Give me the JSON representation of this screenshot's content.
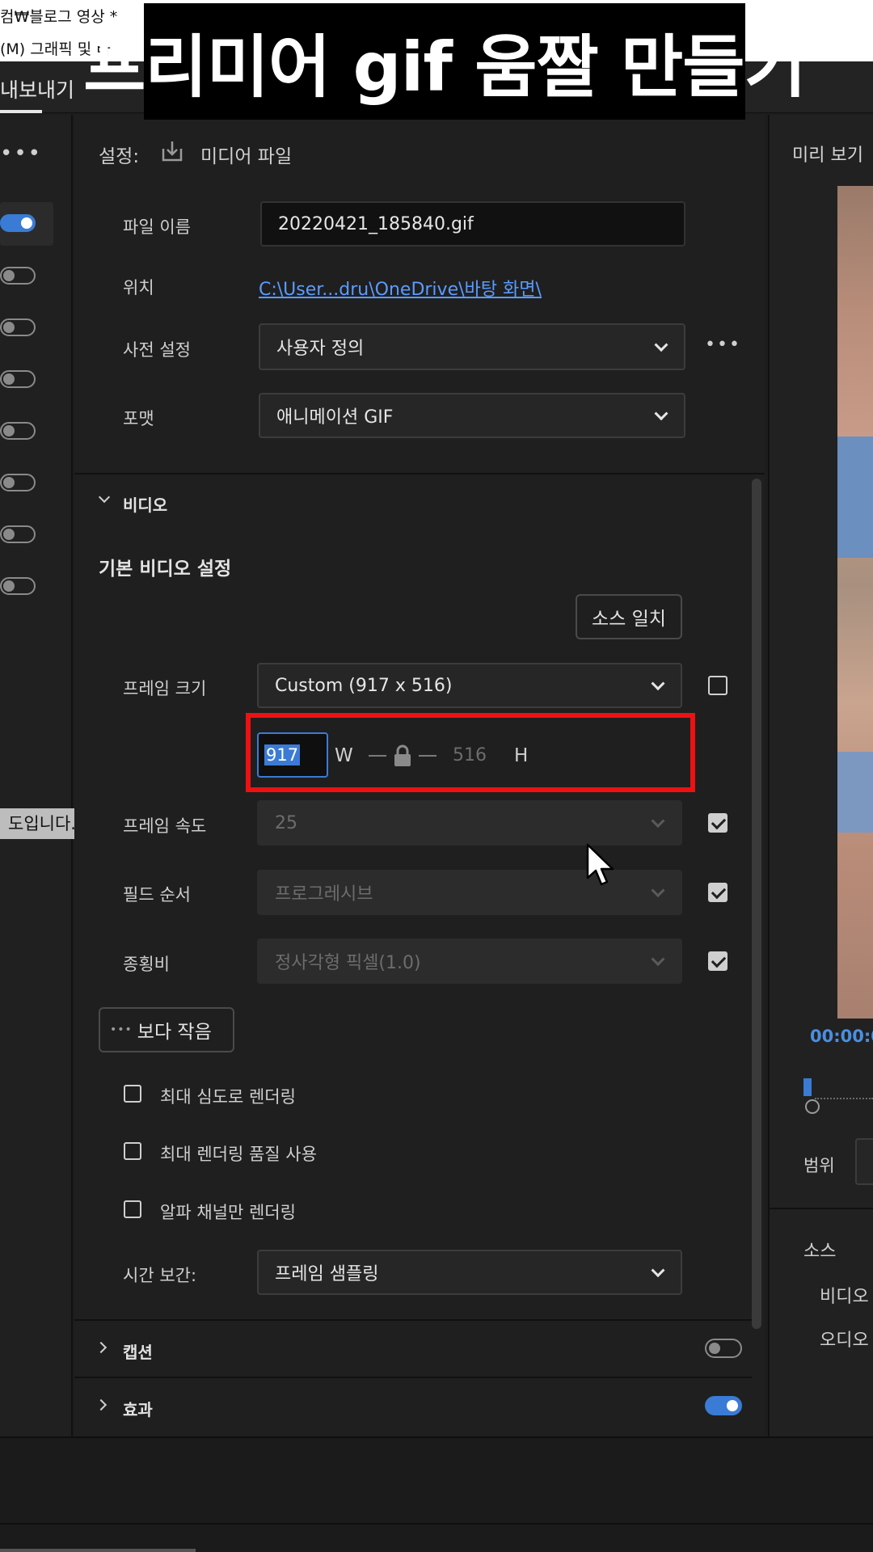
{
  "window": {
    "title": "컴₩블로그 영상 *",
    "menu_text": "(M)    그래픽 및 타"
  },
  "banner": {
    "text": "프리미어 gif 움짤 만들기"
  },
  "tabs": {
    "export_label": "내보내기"
  },
  "left_panel": {
    "more": "•••",
    "tooltip": "도입니다."
  },
  "settings": {
    "header_label": "설정:",
    "media_file_label": "미디어 파일",
    "file_name_label": "파일 이름",
    "file_name_value": "20220421_185840.gif",
    "location_label": "위치",
    "location_value": "C:\\User...dru\\OneDrive\\바탕 화면\\",
    "preset_label": "사전 설정",
    "preset_value": "사용자 정의",
    "preset_more": "•••",
    "format_label": "포맷",
    "format_value": "애니메이션 GIF"
  },
  "video": {
    "section_label": "비디오",
    "basic_settings_title": "기본 비디오 설정",
    "match_source_label": "소스 일치",
    "frame_size_label": "프레임 크기",
    "frame_size_value": "Custom (917 x 516)",
    "width_value": "917",
    "width_unit": "W",
    "height_value": "516",
    "height_unit": "H",
    "frame_rate_label": "프레임 속도",
    "frame_rate_value": "25",
    "field_order_label": "필드 순서",
    "field_order_value": "프로그레시브",
    "aspect_label": "종횡비",
    "aspect_value": "정사각형 픽셀(1.0)",
    "show_less_label": "보다 작음",
    "show_less_dots": "•••",
    "max_depth_label": "최대 심도로 렌더링",
    "max_quality_label": "최대 렌더링 품질 사용",
    "alpha_only_label": "알파 채널만 렌더링",
    "time_interp_label": "시간 보간:",
    "time_interp_value": "프레임 샘플링"
  },
  "sections": {
    "captions_label": "캡션",
    "effects_label": "효과"
  },
  "right_panel": {
    "preview_label": "미리 보기",
    "timecode": "00:00:0",
    "range_label": "범위",
    "source_label": "소스",
    "video_label": "비디오",
    "audio_label": "오디오"
  },
  "colors": {
    "accent": "#3a7bd5",
    "highlight_box": "#e11111",
    "link": "#5b9bff",
    "timecode": "#4a8fe0"
  }
}
